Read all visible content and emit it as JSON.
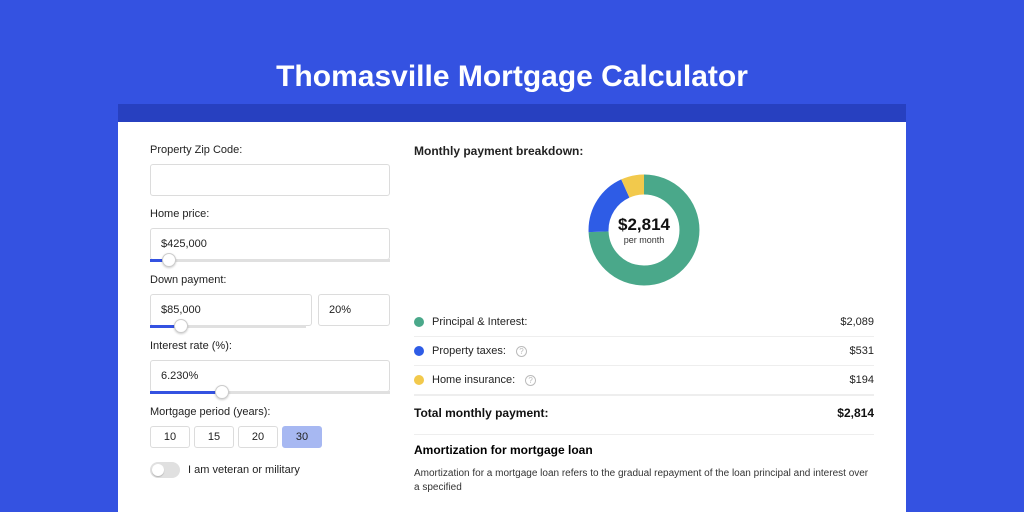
{
  "title": "Thomasville Mortgage Calculator",
  "form": {
    "zip_label": "Property Zip Code:",
    "zip_value": "",
    "home_price_label": "Home price:",
    "home_price_value": "$425,000",
    "home_price_slider_pct": 8,
    "down_payment_label": "Down payment:",
    "down_payment_value": "$85,000",
    "down_payment_percent_value": "20%",
    "down_payment_slider_pct": 20,
    "interest_label": "Interest rate (%):",
    "interest_value": "6.230%",
    "interest_slider_pct": 30,
    "period_label": "Mortgage period (years):",
    "periods": [
      "10",
      "15",
      "20",
      "30"
    ],
    "period_active": "30",
    "veteran_label": "I am veteran or military"
  },
  "breakdown": {
    "title": "Monthly payment breakdown:",
    "center_amount": "$2,814",
    "center_sub": "per month",
    "items": [
      {
        "label": "Principal & Interest:",
        "value": "$2,089",
        "color": "#4aa88a",
        "has_info": false
      },
      {
        "label": "Property taxes:",
        "value": "$531",
        "color": "#2e5ce6",
        "has_info": true
      },
      {
        "label": "Home insurance:",
        "value": "$194",
        "color": "#f2c94c",
        "has_info": true
      }
    ],
    "total_label": "Total monthly payment:",
    "total_value": "$2,814"
  },
  "chart_data": {
    "type": "pie",
    "title": "Monthly payment breakdown",
    "series": [
      {
        "name": "Principal & Interest",
        "value": 2089,
        "color": "#4aa88a"
      },
      {
        "name": "Property taxes",
        "value": 531,
        "color": "#2e5ce6"
      },
      {
        "name": "Home insurance",
        "value": 194,
        "color": "#f2c94c"
      }
    ],
    "total": 2814,
    "center_label": "$2,814",
    "center_sub": "per month"
  },
  "amortization": {
    "title": "Amortization for mortgage loan",
    "text": "Amortization for a mortgage loan refers to the gradual repayment of the loan principal and interest over a specified"
  }
}
